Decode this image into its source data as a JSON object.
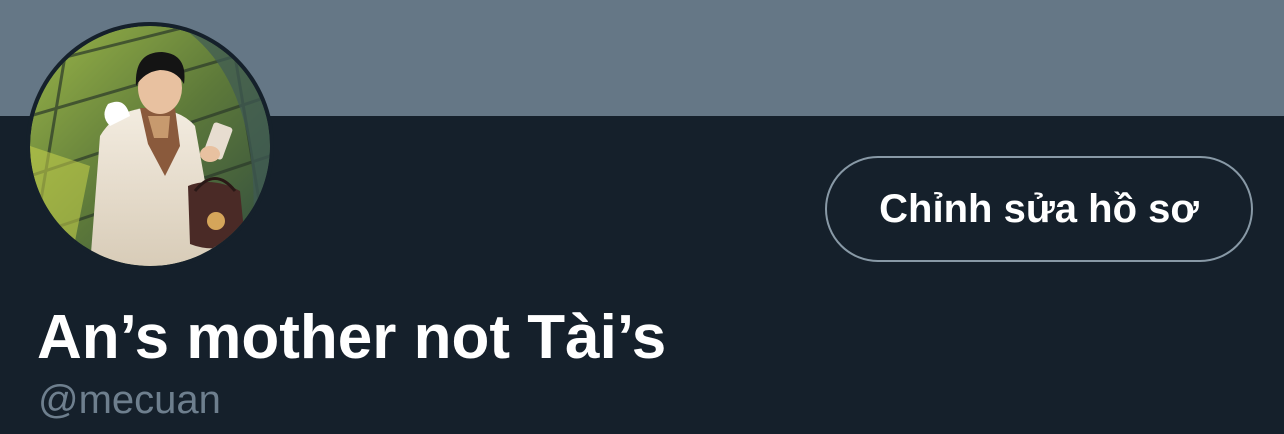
{
  "profile": {
    "display_name": "An’s mother not Tài’s",
    "handle": "@mecuan",
    "avatar_description": "profile-photo",
    "edit_profile_label": "Chỉnh sửa hồ sơ"
  },
  "colors": {
    "banner": "#657786",
    "background": "#15202b",
    "text_primary": "#ffffff",
    "text_secondary": "#6e7f8e",
    "button_border": "#8899a6"
  }
}
